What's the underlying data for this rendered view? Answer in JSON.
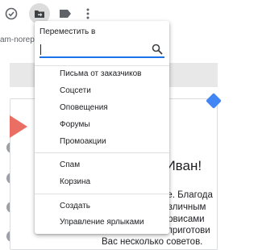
{
  "toolbar": {
    "icons": [
      "select-checkbox-icon",
      "move-to-icon",
      "label-icon",
      "more-vert-icon"
    ]
  },
  "email": {
    "sender_fragment": "am-noreply",
    "greeting": ", Иван!",
    "lines": [
      "ogle. Благода",
      "различным",
      "сервисами",
      "ы приготови",
      "Вас несколько советов."
    ]
  },
  "move_menu": {
    "title": "Переместить в",
    "search_value": "",
    "labels": [
      "Письма от заказчиков",
      "Соцсети",
      "Оповещения",
      "Форумы",
      "Промоакции"
    ],
    "folders": [
      "Спам",
      "Корзина"
    ],
    "actions": [
      "Создать",
      "Управление ярлыками"
    ]
  },
  "colors": {
    "accent": "#1a73e8",
    "brand_red": "#ea6e63",
    "brand_blue": "#4285f4"
  }
}
